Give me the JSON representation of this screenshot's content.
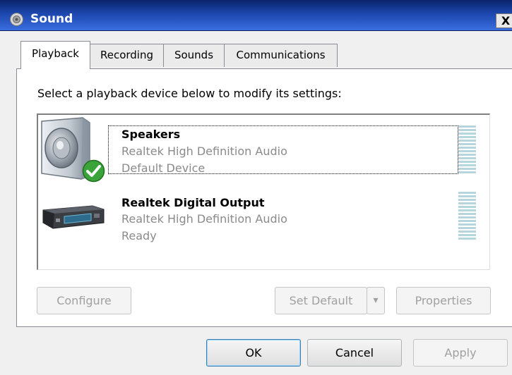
{
  "window": {
    "title": "Sound",
    "close_glyph": "X"
  },
  "tabs": [
    {
      "label": "Playback",
      "active": true
    },
    {
      "label": "Recording",
      "active": false
    },
    {
      "label": "Sounds",
      "active": false
    },
    {
      "label": "Communications",
      "active": false
    }
  ],
  "playback": {
    "instruction": "Select a playback device below to modify its settings:",
    "devices": [
      {
        "name": "Speakers",
        "driver": "Realtek High Definition Audio",
        "status": "Default Device",
        "icon": "speaker-icon",
        "is_default": true,
        "selected": true
      },
      {
        "name": "Realtek Digital Output",
        "driver": "Realtek High Definition Audio",
        "status": "Ready",
        "icon": "digital-output-icon",
        "is_default": false,
        "selected": false
      }
    ],
    "buttons": {
      "configure": "Configure",
      "set_default": "Set Default",
      "set_default_arrow": "▾",
      "properties": "Properties"
    }
  },
  "footer": {
    "ok": "OK",
    "cancel": "Cancel",
    "apply": "Apply"
  },
  "colors": {
    "title_bar": "#1c47ae",
    "meter": "#b7d5dc",
    "default_badge": "#3aa43a"
  }
}
